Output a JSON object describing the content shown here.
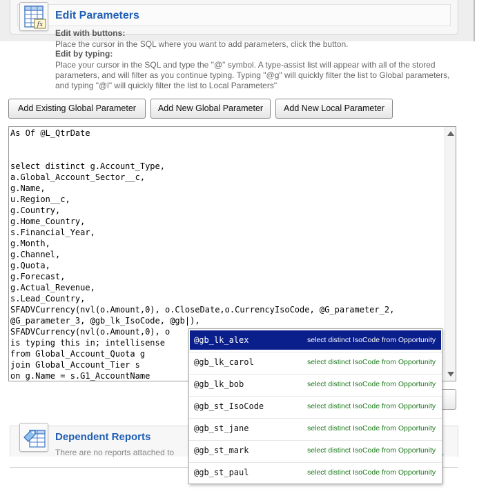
{
  "header": {
    "title": "Edit Parameters",
    "icon": "table-function-icon"
  },
  "help": {
    "buttons_heading": "Edit with buttons:",
    "buttons_text": "Place the cursor in the SQL where you want to add parameters, click the button.",
    "typing_heading": "Edit by typing:",
    "typing_text": "Place your cursor in the SQL and type the \"@\" symbol. A type-assist list will appear with all of the stored parameters, and will filter as you continue typing. Typing \"@g\" will quickly filter the list to Global parameters, and typing \"@l\" will quickly filter the list to Local Parameters\""
  },
  "toolbar": {
    "add_existing_global": "Add Existing Global Parameter",
    "add_new_global": "Add New Global Parameter",
    "add_new_local": "Add New Local Parameter"
  },
  "editor": {
    "sql": "As Of @L_QtrDate\n\n\nselect distinct g.Account_Type,\na.Global_Account_Sector__c,\ng.Name,\nu.Region__c,\ng.Country,\ng.Home_Country,\ns.Financial_Year,\ng.Month,\ng.Channel,\ng.Quota,\ng.Forecast,\ng.Actual_Revenue,\ns.Lead_Country,\nSFADVCurrency(nvl(o.Amount,0), o.CloseDate,o.CurrencyIsoCode, @G_parameter_2,\n@G_parameter_3, @gb_lk_IsoCode, @gb|),\nSFADVCurrency(nvl(o.Amount,0), o\nis typing this in; intellisense\nfrom Global_Account_Quota g\njoin Global_Account_Tier s\non g.Name = s.G1_AccountName"
  },
  "autocomplete": {
    "items": [
      {
        "name": "@gb_lk_alex",
        "desc": "select distinct IsoCode from Opportunity",
        "selected": true
      },
      {
        "name": "@gb_lk_carol",
        "desc": "select distinct IsoCode from Opportunity"
      },
      {
        "name": "@gb_lk_bob",
        "desc": "select distinct IsoCode from Opportunity"
      },
      {
        "name": "@gb_st_IsoCode",
        "desc": "select distinct IsoCode from Opportunity"
      },
      {
        "name": "@gb_st_jane",
        "desc": "select distinct IsoCode from Opportunity"
      },
      {
        "name": "@gb_st_mark",
        "desc": "select distinct IsoCode from Opportunity"
      },
      {
        "name": "@gb_st_paul",
        "desc": "select distinct IsoCode from Opportunity"
      }
    ]
  },
  "dependent": {
    "title": "Dependent Reports",
    "icon": "tag-table-icon",
    "text": "There are no reports attached to",
    "tail": "."
  },
  "colors": {
    "accent": "#1f5fb4",
    "selection": "#0a1e8c",
    "desc_green": "#1a7a1a"
  }
}
